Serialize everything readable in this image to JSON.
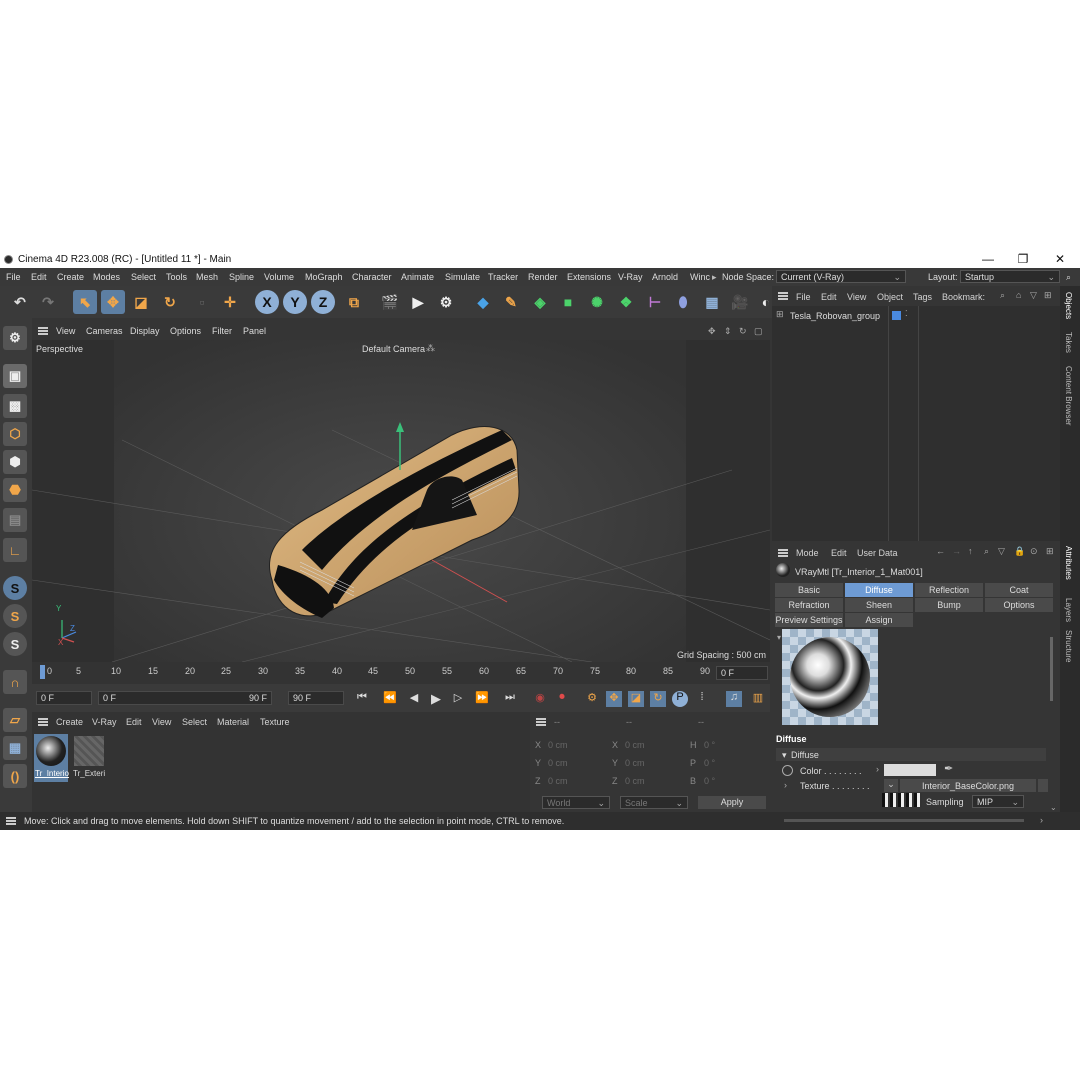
{
  "window": {
    "title": "Cinema 4D R23.008 (RC) - [Untitled 11 *] - Main",
    "minimize": "—",
    "maximize": "❐",
    "close": "✕"
  },
  "menu": {
    "items": [
      "File",
      "Edit",
      "Create",
      "Modes",
      "Select",
      "Tools",
      "Mesh",
      "Spline",
      "Volume",
      "MoGraph",
      "Character",
      "Animate",
      "Simulate",
      "Tracker",
      "Render",
      "Extensions",
      "V-Ray",
      "Arnold",
      "Winc"
    ],
    "more_arrow": "▸",
    "node_space_label": "Node Space:",
    "node_space_value": "Current (V-Ray)",
    "layout_label": "Layout:",
    "layout_value": "Startup"
  },
  "toolbar": {
    "x_label": "X",
    "y_label": "Y",
    "z_label": "Z"
  },
  "viewport": {
    "menu": [
      "View",
      "Cameras",
      "Display",
      "Options",
      "Filter",
      "Panel"
    ],
    "name": "Perspective",
    "camera": "Default Camera",
    "grid_spacing": "Grid Spacing : 500 cm",
    "axis_y": "Y",
    "axis_z": "Z",
    "axis_x": "X"
  },
  "timeline": {
    "ticks": [
      "0",
      "5",
      "10",
      "15",
      "20",
      "25",
      "30",
      "35",
      "40",
      "45",
      "50",
      "55",
      "60",
      "65",
      "70",
      "75",
      "80",
      "85",
      "90"
    ],
    "current_frame": "0 F"
  },
  "playback": {
    "start": "0 F",
    "range_start": "0 F",
    "range_end": "90 F",
    "end": "90 F"
  },
  "material_manager": {
    "menu": [
      "Create",
      "V-Ray",
      "Edit",
      "View",
      "Select",
      "Material",
      "Texture"
    ],
    "materials": [
      {
        "name": "Tr_Interio"
      },
      {
        "name": "Tr_Exteri"
      }
    ]
  },
  "coords": {
    "header": [
      "--",
      "--",
      "--"
    ],
    "rows": [
      {
        "a": "X",
        "av": "0 cm",
        "b": "X",
        "bv": "0 cm",
        "c": "H",
        "cv": "0 °"
      },
      {
        "a": "Y",
        "av": "0 cm",
        "b": "Y",
        "bv": "0 cm",
        "c": "P",
        "cv": "0 °"
      },
      {
        "a": "Z",
        "av": "0 cm",
        "b": "Z",
        "bv": "0 cm",
        "c": "B",
        "cv": "0 °"
      }
    ],
    "space": "World",
    "mode": "Scale",
    "apply": "Apply"
  },
  "status": "Move: Click and drag to move elements. Hold down SHIFT to quantize movement / add to the selection in point mode, CTRL to remove.",
  "objects": {
    "menu": [
      "File",
      "Edit",
      "View",
      "Object",
      "Tags",
      "Bookmark:"
    ],
    "tree": [
      {
        "name": "Tesla_Robovan_group"
      }
    ]
  },
  "attributes": {
    "menu": [
      "Mode",
      "Edit",
      "User Data"
    ],
    "material_title": "VRayMtl [Tr_Interior_1_Mat001]",
    "tabs_row1": [
      "Basic",
      "Diffuse",
      "Reflection",
      "Coat"
    ],
    "tabs_row2": [
      "Refraction",
      "Sheen",
      "Bump",
      "Options"
    ],
    "tabs_row3": [
      "Preview Settings",
      "Assign"
    ],
    "section": "Diffuse",
    "subsection": "Diffuse",
    "color_label": "Color . . . . . . . .",
    "texture_label": "Texture . . . . . . . .",
    "texture_file": "Interior_BaseColor.png",
    "sampling_label": "Sampling",
    "sampling_value": "MIP"
  },
  "side_tabs": {
    "top": [
      "Objects",
      "Takes",
      "Content Browser"
    ],
    "bottom": [
      "Attributes",
      "Layers",
      "Structure"
    ]
  },
  "colors": {
    "accent": "#6e9bd4",
    "background": "#353535",
    "vehicle_body": "#d3aa74"
  }
}
